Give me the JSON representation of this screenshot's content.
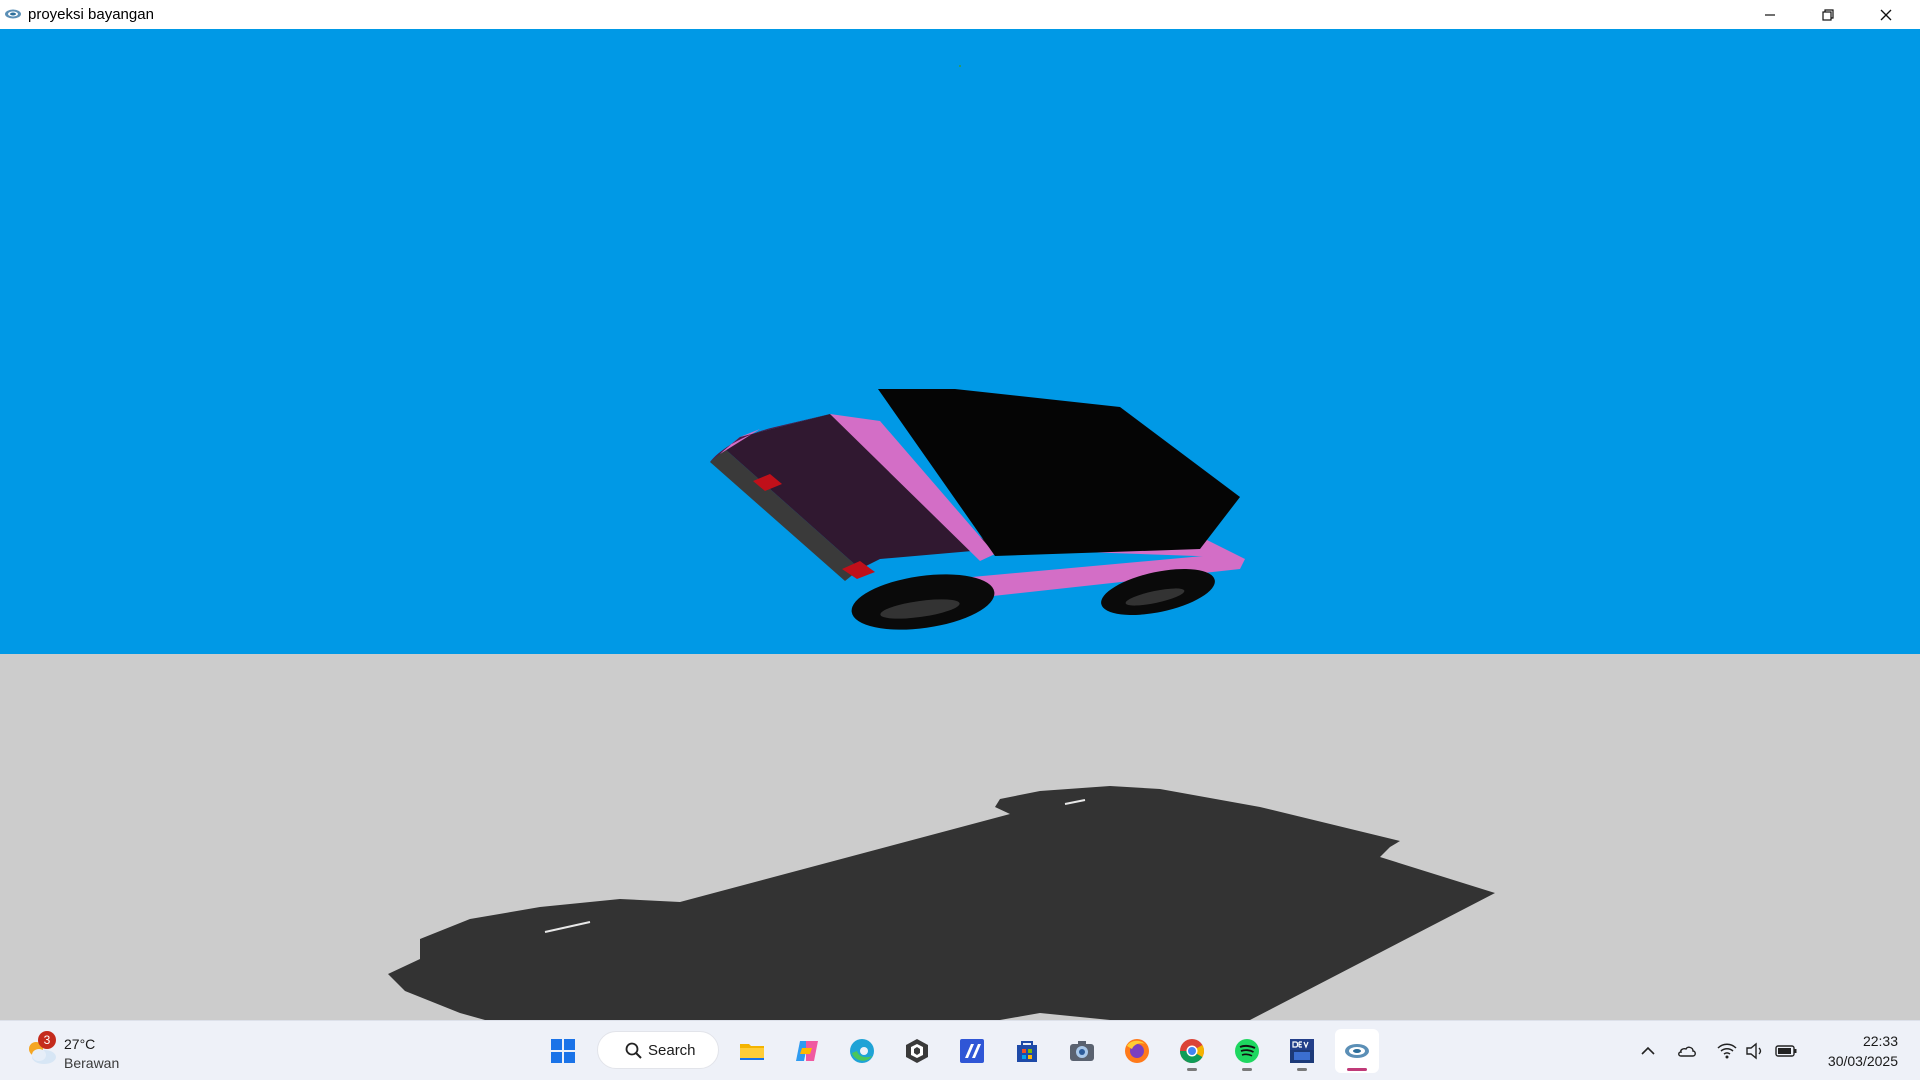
{
  "window": {
    "title": "proyeksi bayangan",
    "controls": [
      "minimize",
      "restore",
      "close"
    ]
  },
  "scene": {
    "sky_color": "#0099e6",
    "ground_color": "#cccccc",
    "shadow_color": "#333333",
    "car_body_color": "#d36ec6",
    "car_roof_color": "#050505",
    "car_rear_color": "#301830",
    "tail_light_color": "#c0101a",
    "wheel_color": "#0a0a0a"
  },
  "taskbar": {
    "weather": {
      "badge": "3",
      "temperature": "27°C",
      "condition": "Berawan",
      "icon": "partly-cloudy-icon"
    },
    "search_label": "Search",
    "pinned_apps": [
      {
        "name": "start",
        "icon": "windows-start-icon"
      },
      {
        "name": "file-explorer",
        "icon": "folder-icon"
      },
      {
        "name": "copilot",
        "icon": "copilot-icon"
      },
      {
        "name": "edge",
        "icon": "edge-icon"
      },
      {
        "name": "unity-hub",
        "icon": "cube-icon"
      },
      {
        "name": "visual-studio",
        "icon": "vs-icon"
      },
      {
        "name": "microsoft-store",
        "icon": "store-icon"
      },
      {
        "name": "camera",
        "icon": "camera-icon"
      },
      {
        "name": "firefox",
        "icon": "firefox-icon"
      },
      {
        "name": "chrome",
        "icon": "chrome-icon"
      },
      {
        "name": "spotify",
        "icon": "spotify-icon"
      },
      {
        "name": "dev-cpp",
        "icon": "devcpp-icon"
      },
      {
        "name": "opengl-app",
        "icon": "opengl-icon"
      }
    ],
    "tray": [
      "chevron-up-icon",
      "onedrive-cloud-icon",
      "wifi-icon",
      "volume-icon",
      "battery-icon"
    ],
    "clock": {
      "time": "22:33",
      "date": "30/03/2025"
    }
  }
}
